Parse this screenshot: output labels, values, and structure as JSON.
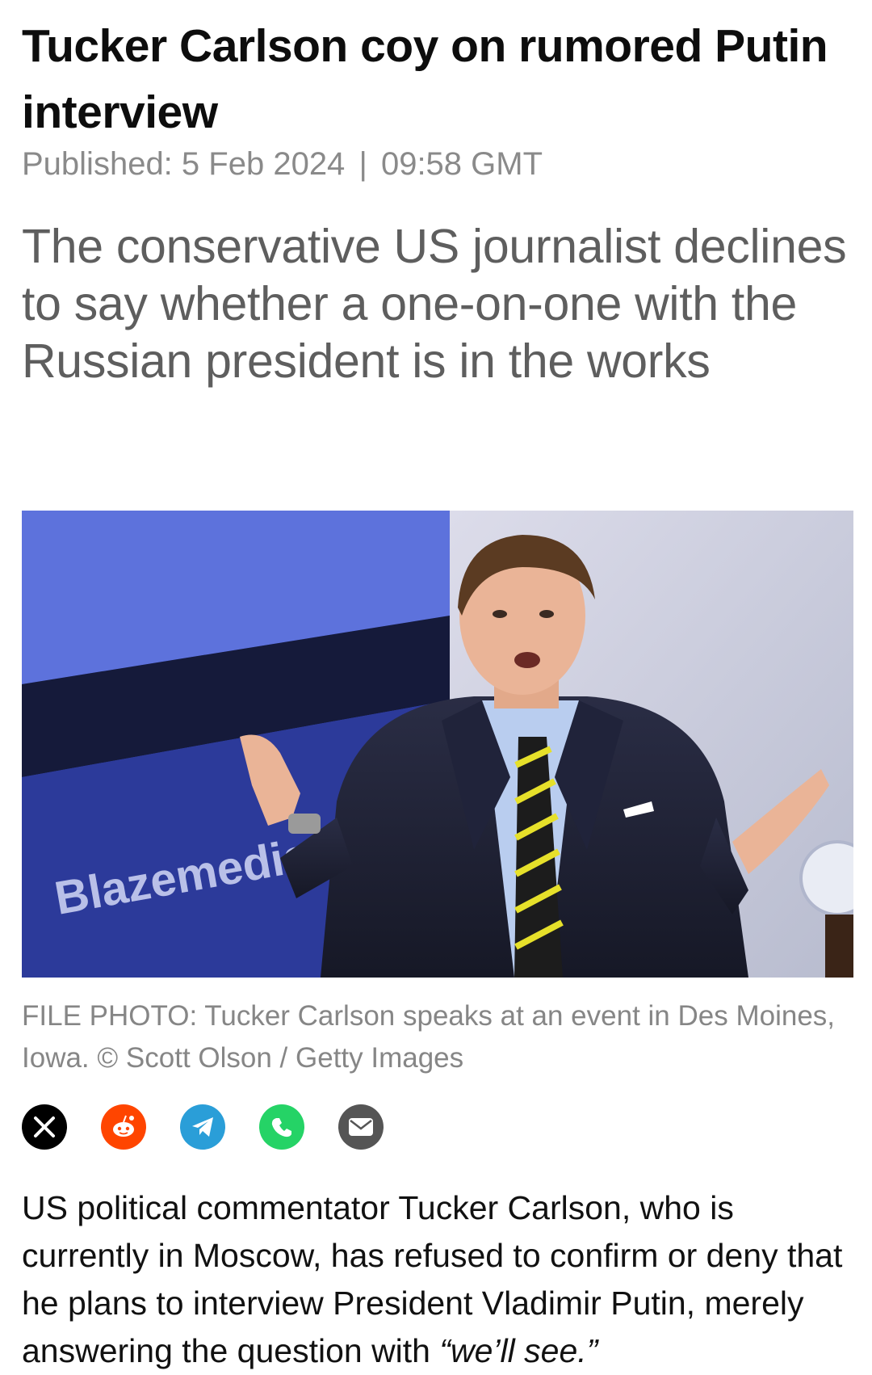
{
  "article": {
    "headline": "Tucker Carlson coy on rumored Putin interview",
    "published_label": "Published:",
    "published_date": "5 Feb 2024",
    "published_separator": "|",
    "published_time": "09:58 GMT",
    "summary": "The conservative US journalist declines to say whether a one-on-one with the Russian president is in the works",
    "photo": {
      "backdrop_text": "Blazemedia",
      "caption_prefix": "FILE PHOTO: Tucker Carlson speaks at an event in Des Moines, Iowa.",
      "copyright_symbol": "©",
      "caption_credit": "Scott Olson / Getty Images"
    },
    "share": {
      "buttons": [
        {
          "icon": "x-icon",
          "color": "#000000"
        },
        {
          "icon": "reddit-icon",
          "color": "#ff4500"
        },
        {
          "icon": "telegram-icon",
          "color": "#2a9ed8"
        },
        {
          "icon": "whatsapp-icon",
          "color": "#25d366"
        },
        {
          "icon": "email-icon",
          "color": "#555555"
        }
      ]
    },
    "body": {
      "paragraph_1_text": "US political commentator Tucker Carlson, who is currently in Moscow, has refused to confirm or deny that he plans to interview President Vladimir Putin, merely answering the question with ",
      "paragraph_1_quote": "“we’ll see.”"
    }
  }
}
